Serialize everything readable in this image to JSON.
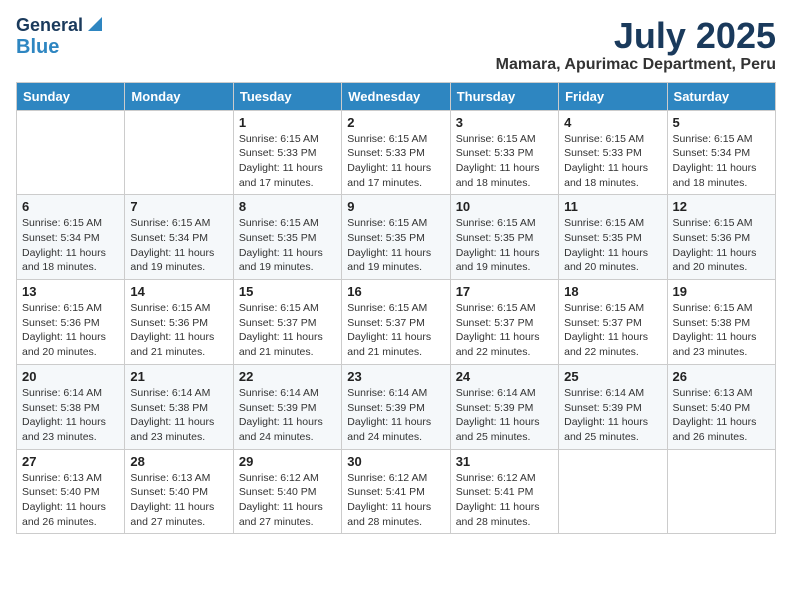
{
  "logo": {
    "general": "General",
    "blue": "Blue"
  },
  "title": "July 2025",
  "location": "Mamara, Apurimac Department, Peru",
  "days_of_week": [
    "Sunday",
    "Monday",
    "Tuesday",
    "Wednesday",
    "Thursday",
    "Friday",
    "Saturday"
  ],
  "weeks": [
    [
      {
        "day": "",
        "info": ""
      },
      {
        "day": "",
        "info": ""
      },
      {
        "day": "1",
        "info": "Sunrise: 6:15 AM\nSunset: 5:33 PM\nDaylight: 11 hours and 17 minutes."
      },
      {
        "day": "2",
        "info": "Sunrise: 6:15 AM\nSunset: 5:33 PM\nDaylight: 11 hours and 17 minutes."
      },
      {
        "day": "3",
        "info": "Sunrise: 6:15 AM\nSunset: 5:33 PM\nDaylight: 11 hours and 18 minutes."
      },
      {
        "day": "4",
        "info": "Sunrise: 6:15 AM\nSunset: 5:33 PM\nDaylight: 11 hours and 18 minutes."
      },
      {
        "day": "5",
        "info": "Sunrise: 6:15 AM\nSunset: 5:34 PM\nDaylight: 11 hours and 18 minutes."
      }
    ],
    [
      {
        "day": "6",
        "info": "Sunrise: 6:15 AM\nSunset: 5:34 PM\nDaylight: 11 hours and 18 minutes."
      },
      {
        "day": "7",
        "info": "Sunrise: 6:15 AM\nSunset: 5:34 PM\nDaylight: 11 hours and 19 minutes."
      },
      {
        "day": "8",
        "info": "Sunrise: 6:15 AM\nSunset: 5:35 PM\nDaylight: 11 hours and 19 minutes."
      },
      {
        "day": "9",
        "info": "Sunrise: 6:15 AM\nSunset: 5:35 PM\nDaylight: 11 hours and 19 minutes."
      },
      {
        "day": "10",
        "info": "Sunrise: 6:15 AM\nSunset: 5:35 PM\nDaylight: 11 hours and 19 minutes."
      },
      {
        "day": "11",
        "info": "Sunrise: 6:15 AM\nSunset: 5:35 PM\nDaylight: 11 hours and 20 minutes."
      },
      {
        "day": "12",
        "info": "Sunrise: 6:15 AM\nSunset: 5:36 PM\nDaylight: 11 hours and 20 minutes."
      }
    ],
    [
      {
        "day": "13",
        "info": "Sunrise: 6:15 AM\nSunset: 5:36 PM\nDaylight: 11 hours and 20 minutes."
      },
      {
        "day": "14",
        "info": "Sunrise: 6:15 AM\nSunset: 5:36 PM\nDaylight: 11 hours and 21 minutes."
      },
      {
        "day": "15",
        "info": "Sunrise: 6:15 AM\nSunset: 5:37 PM\nDaylight: 11 hours and 21 minutes."
      },
      {
        "day": "16",
        "info": "Sunrise: 6:15 AM\nSunset: 5:37 PM\nDaylight: 11 hours and 21 minutes."
      },
      {
        "day": "17",
        "info": "Sunrise: 6:15 AM\nSunset: 5:37 PM\nDaylight: 11 hours and 22 minutes."
      },
      {
        "day": "18",
        "info": "Sunrise: 6:15 AM\nSunset: 5:37 PM\nDaylight: 11 hours and 22 minutes."
      },
      {
        "day": "19",
        "info": "Sunrise: 6:15 AM\nSunset: 5:38 PM\nDaylight: 11 hours and 23 minutes."
      }
    ],
    [
      {
        "day": "20",
        "info": "Sunrise: 6:14 AM\nSunset: 5:38 PM\nDaylight: 11 hours and 23 minutes."
      },
      {
        "day": "21",
        "info": "Sunrise: 6:14 AM\nSunset: 5:38 PM\nDaylight: 11 hours and 23 minutes."
      },
      {
        "day": "22",
        "info": "Sunrise: 6:14 AM\nSunset: 5:39 PM\nDaylight: 11 hours and 24 minutes."
      },
      {
        "day": "23",
        "info": "Sunrise: 6:14 AM\nSunset: 5:39 PM\nDaylight: 11 hours and 24 minutes."
      },
      {
        "day": "24",
        "info": "Sunrise: 6:14 AM\nSunset: 5:39 PM\nDaylight: 11 hours and 25 minutes."
      },
      {
        "day": "25",
        "info": "Sunrise: 6:14 AM\nSunset: 5:39 PM\nDaylight: 11 hours and 25 minutes."
      },
      {
        "day": "26",
        "info": "Sunrise: 6:13 AM\nSunset: 5:40 PM\nDaylight: 11 hours and 26 minutes."
      }
    ],
    [
      {
        "day": "27",
        "info": "Sunrise: 6:13 AM\nSunset: 5:40 PM\nDaylight: 11 hours and 26 minutes."
      },
      {
        "day": "28",
        "info": "Sunrise: 6:13 AM\nSunset: 5:40 PM\nDaylight: 11 hours and 27 minutes."
      },
      {
        "day": "29",
        "info": "Sunrise: 6:12 AM\nSunset: 5:40 PM\nDaylight: 11 hours and 27 minutes."
      },
      {
        "day": "30",
        "info": "Sunrise: 6:12 AM\nSunset: 5:41 PM\nDaylight: 11 hours and 28 minutes."
      },
      {
        "day": "31",
        "info": "Sunrise: 6:12 AM\nSunset: 5:41 PM\nDaylight: 11 hours and 28 minutes."
      },
      {
        "day": "",
        "info": ""
      },
      {
        "day": "",
        "info": ""
      }
    ]
  ]
}
